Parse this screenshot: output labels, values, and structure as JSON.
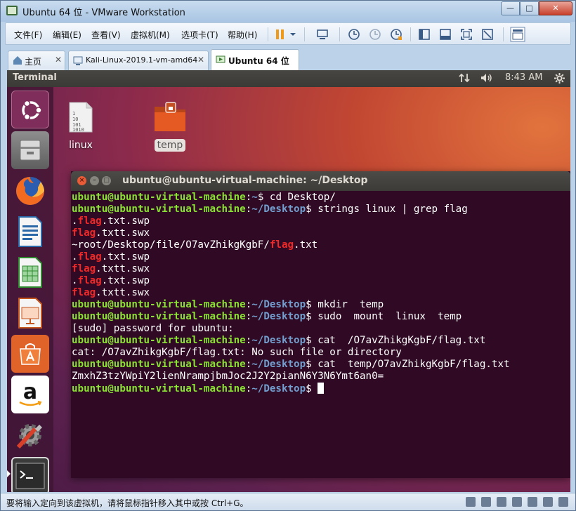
{
  "vmware": {
    "window_title": "Ubuntu 64 位 - VMware Workstation",
    "menu": [
      "文件(F)",
      "编辑(E)",
      "查看(V)",
      "虚拟机(M)",
      "选项卡(T)",
      "帮助(H)"
    ],
    "tabs": [
      {
        "label": "主页",
        "active": false
      },
      {
        "label": "Kali-Linux-2019.1-vm-amd64",
        "active": false
      },
      {
        "label": "Ubuntu 64 位",
        "active": true
      }
    ],
    "status_message": "要将输入定向到该虚拟机，请将鼠标指针移入其中或按 Ctrl+G。"
  },
  "ubuntu": {
    "top_app": "Terminal",
    "clock": "8:43 AM",
    "desktop_icons": [
      {
        "label": "linux",
        "icon": "text-file-icon"
      },
      {
        "label": "temp",
        "icon": "folder-icon",
        "selected": true
      }
    ],
    "launcher": [
      "ubuntu-dash-icon",
      "files-icon",
      "firefox-icon",
      "writer-icon",
      "calc-icon",
      "impress-icon",
      "software-center-icon",
      "amazon-icon",
      "settings-icon",
      "terminal-icon"
    ]
  },
  "terminal": {
    "title": "ubuntu@ubuntu-virtual-machine: ~/Desktop",
    "user_host": "ubuntu@ubuntu-virtual-machine",
    "lines": [
      {
        "kind": "prompt",
        "path": "~",
        "cmd": " cd Desktop/"
      },
      {
        "kind": "prompt",
        "path": "~/Desktop",
        "cmd": " strings linux | grep flag"
      },
      {
        "kind": "out",
        "pre": ".",
        "red": "flag",
        "post": ".txt.swp"
      },
      {
        "kind": "out",
        "pre": "",
        "red": "flag",
        "post": ".txtt.swx"
      },
      {
        "kind": "out",
        "pre": "~root/Desktop/file/O7avZhikgKgbF/",
        "red": "flag",
        "post": ".txt"
      },
      {
        "kind": "out",
        "pre": ".",
        "red": "flag",
        "post": ".txt.swp"
      },
      {
        "kind": "out",
        "pre": "",
        "red": "flag",
        "post": ".txtt.swx"
      },
      {
        "kind": "out",
        "pre": ".",
        "red": "flag",
        "post": ".txt.swp"
      },
      {
        "kind": "out",
        "pre": "",
        "red": "flag",
        "post": ".txtt.swx"
      },
      {
        "kind": "prompt",
        "path": "~/Desktop",
        "cmd": " mkdir  temp"
      },
      {
        "kind": "prompt",
        "path": "~/Desktop",
        "cmd": " sudo  mount  linux  temp"
      },
      {
        "kind": "plain",
        "text": "[sudo] password for ubuntu:"
      },
      {
        "kind": "prompt",
        "path": "~/Desktop",
        "cmd": " cat  /O7avZhikgKgbF/flag.txt"
      },
      {
        "kind": "plain",
        "text": "cat: /O7avZhikgKgbF/flag.txt: No such file or directory"
      },
      {
        "kind": "prompt",
        "path": "~/Desktop",
        "cmd": " cat  temp/O7avZhikgKgbF/flag.txt"
      },
      {
        "kind": "plain",
        "text": "ZmxhZ3tzYWpiY2lienNrampjbmJoc2J2Y2pianN6Y3N6Ymt6an0="
      },
      {
        "kind": "prompt",
        "path": "~/Desktop",
        "cmd": " ",
        "cursor": true
      }
    ]
  }
}
